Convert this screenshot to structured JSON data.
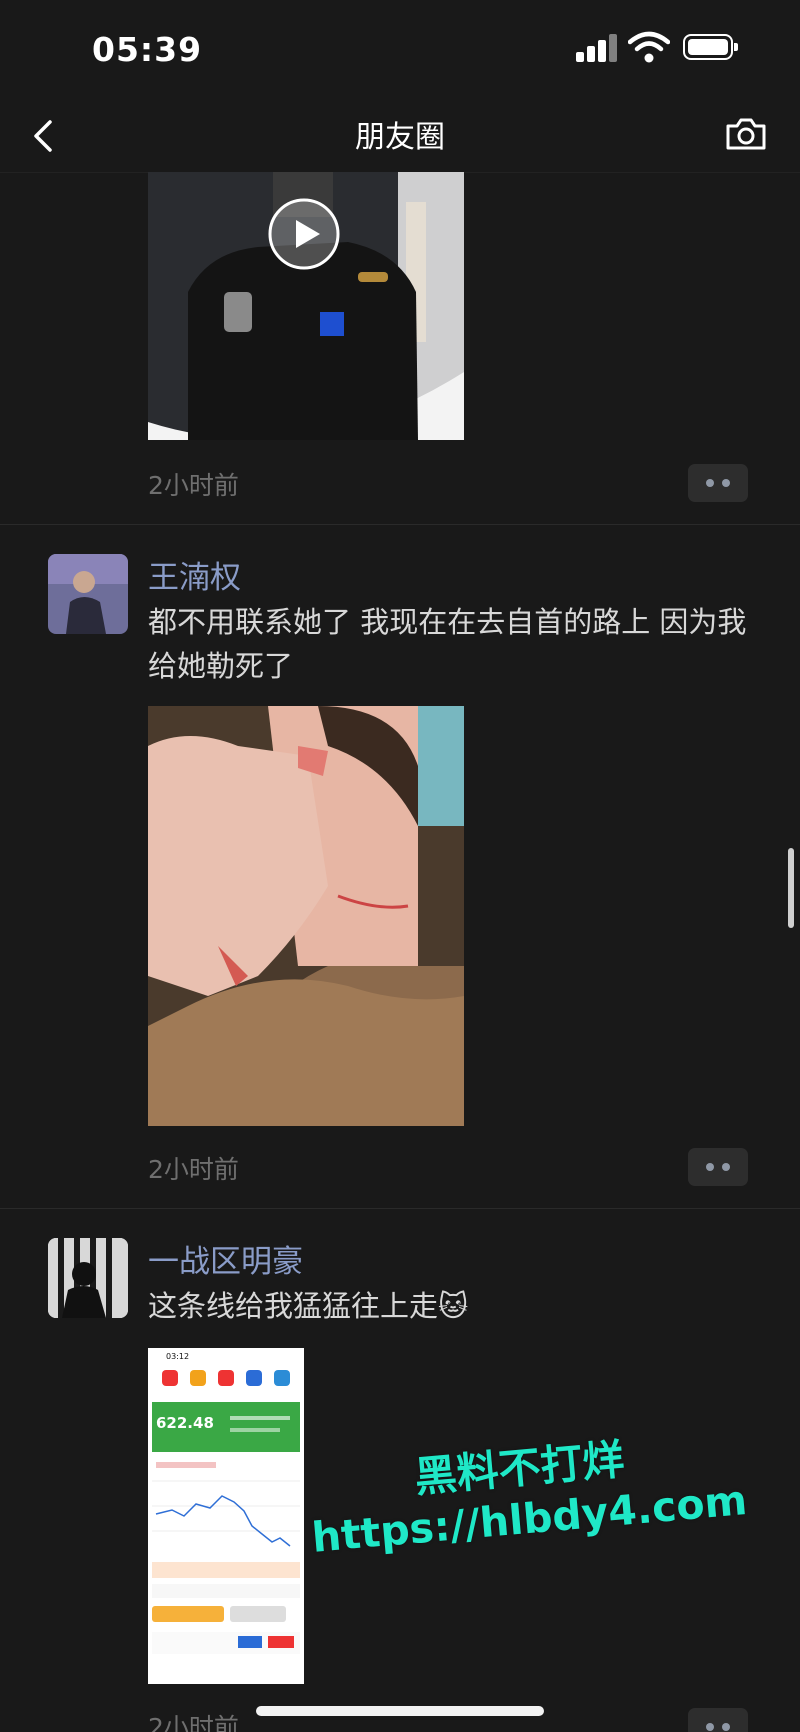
{
  "status_bar": {
    "time": "05:39"
  },
  "nav": {
    "title": "朋友圈"
  },
  "posts": [
    {
      "time": "2小时前"
    },
    {
      "author": "王湳权",
      "text": "都不用联系她了 我现在在去自首的路上 因为我给她勒死了",
      "time": "2小时前"
    },
    {
      "author": "一战区明豪",
      "text": "这条线给我猛猛往上走",
      "emoji": "🐱",
      "time": "2小时前",
      "screenshot": {
        "time": "03:12",
        "price": "622.48"
      }
    }
  ],
  "watermark": {
    "line1": "黑料不打烊",
    "line2": "https://hlbdy4.com"
  },
  "colors": {
    "background": "#191919",
    "author_name": "#8a9cc8",
    "watermark": "#1fe8c7"
  }
}
